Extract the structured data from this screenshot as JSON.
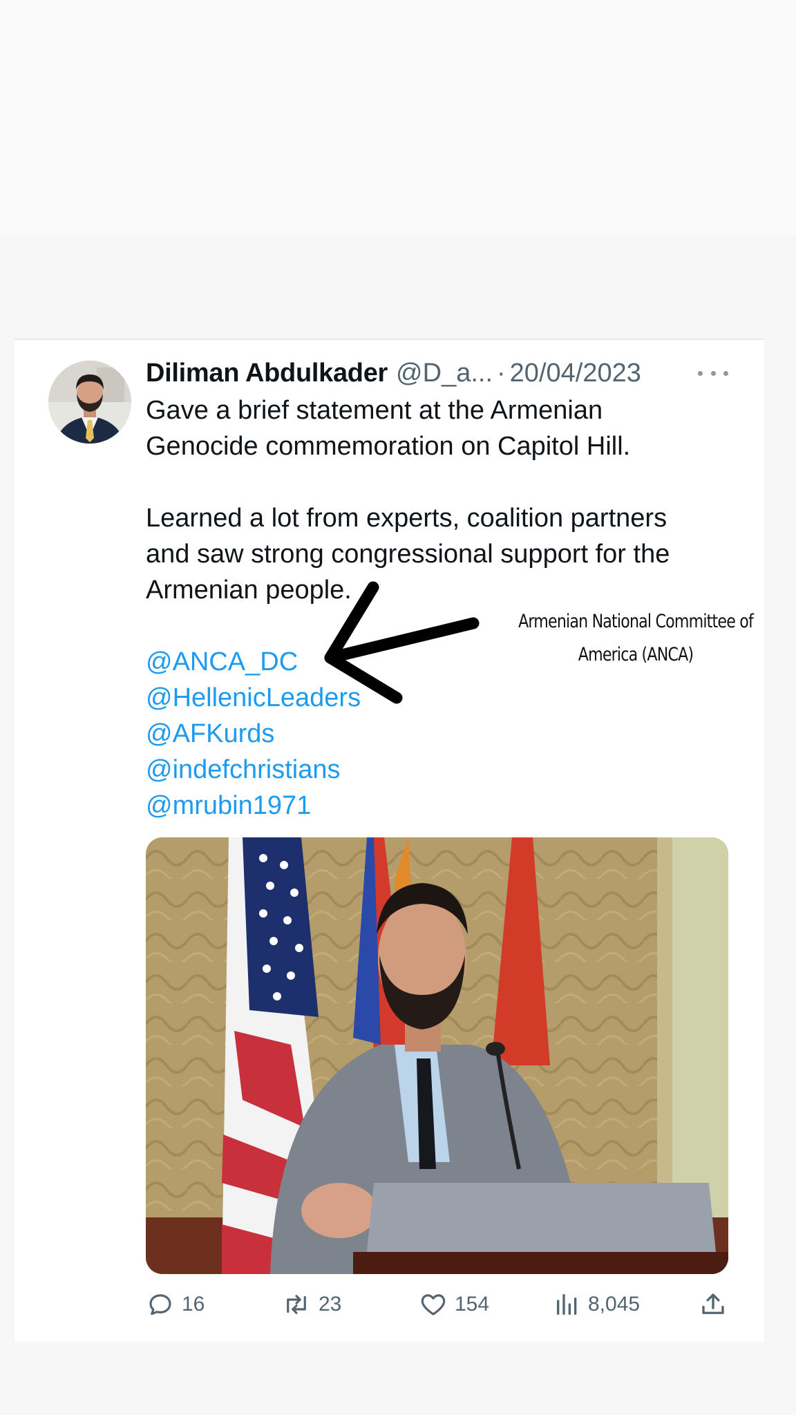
{
  "tweet": {
    "author_name": "Diliman Abdulkader",
    "handle": "@D_a...",
    "separator": "·",
    "date": "20/04/2023",
    "text": {
      "paragraph_1_line_1": "Gave a brief statement at the Armenian",
      "paragraph_1_line_2": "Genocide commemoration on Capitol Hill.",
      "paragraph_2_line_1": "Learned a lot from experts, coalition partners",
      "paragraph_2_line_2": "and saw strong congressional support for the",
      "paragraph_2_line_3": "Armenian people."
    },
    "mentions": [
      "@ANCA_DC",
      "@HellenicLeaders",
      "@AFKurds",
      "@indefchristians",
      "@mrubin1971"
    ],
    "actions": {
      "replies": "16",
      "retweets": "23",
      "likes": "154",
      "views": "8,045"
    }
  },
  "annotation": {
    "line_1": "Armenian National Committee of",
    "line_2": "America (ANCA)"
  },
  "icons": {
    "more": "more-options-icon",
    "reply": "reply-icon",
    "retweet": "retweet-icon",
    "like": "heart-icon",
    "views": "views-icon",
    "share": "share-icon"
  },
  "colors": {
    "link": "#1d9bf0",
    "text": "#0f1419",
    "secondary": "#536471"
  }
}
